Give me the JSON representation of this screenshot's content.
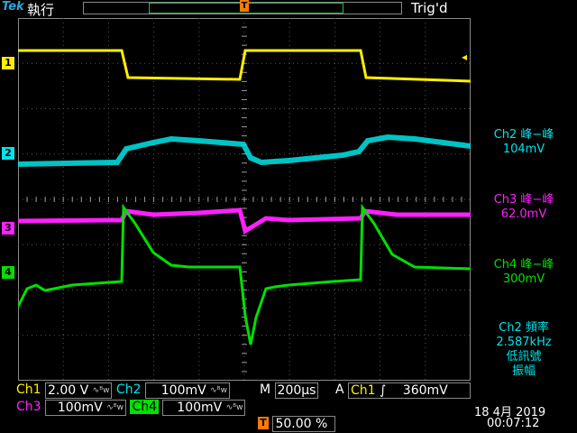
{
  "top": {
    "brand": "Tek",
    "run_state": "執行",
    "trigger_status": "Trig'd",
    "trigger_marker": "T"
  },
  "markers": {
    "ch1": "1",
    "ch2": "2",
    "ch3": "3",
    "ch4": "4",
    "trigger_level": "◂"
  },
  "measurements": {
    "ch2": {
      "label": "Ch2 峰−峰",
      "value": "104mV"
    },
    "ch3": {
      "label": "Ch3 峰−峰",
      "value": "62.0mV"
    },
    "ch4": {
      "label": "Ch4 峰−峰",
      "value": "300mV"
    },
    "freq": {
      "label": "Ch2 頻率",
      "value": "2.587kHz",
      "note1": "低訊號",
      "note2": "振幅"
    }
  },
  "status": {
    "ch1": {
      "name": "Ch1",
      "scale": "2.00 V"
    },
    "ch2": {
      "name": "Ch2",
      "scale": "100mV"
    },
    "ch3": {
      "name": "Ch3",
      "scale": "100mV"
    },
    "ch4": {
      "name": "Ch4",
      "scale": "100mV"
    },
    "bw_symbol": "∿ᴮw",
    "timebase_label": "M",
    "timebase": "200µs",
    "trigger_mode": "A",
    "trigger_source": "Ch1",
    "trigger_slope": "∫",
    "trigger_level": "360mV",
    "trigger_position": "50.00 %",
    "date": "18 4月  2019",
    "time": "00:07:12"
  },
  "colors": {
    "ch1": "#ffee00",
    "ch2": "#00e5e8",
    "ch3": "#ff20ff",
    "ch4": "#00e000",
    "trigger": "#ff7a00"
  }
}
